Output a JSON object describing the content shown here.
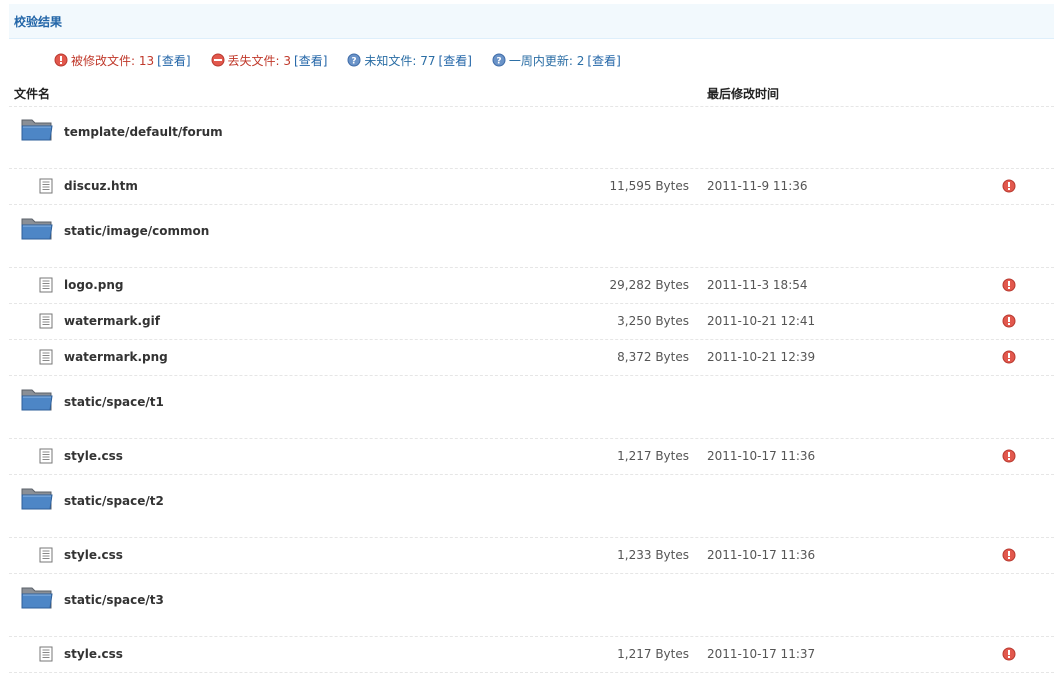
{
  "title": "校验结果",
  "summary": {
    "modified": {
      "label": "被修改文件: 13",
      "view": "[查看]"
    },
    "missing": {
      "label": "丢失文件: 3",
      "view": "[查看]"
    },
    "unknown": {
      "label": "未知文件: 77",
      "view": "[查看]"
    },
    "weekly": {
      "label": "一周内更新: 2",
      "view": "[查看]"
    }
  },
  "header": {
    "name": "文件名",
    "modified_time": "最后修改时间"
  },
  "rows": [
    {
      "type": "folder",
      "name": "template/default/forum"
    },
    {
      "type": "file",
      "name": "discuz.htm",
      "size": "11,595 Bytes",
      "time": "2011-11-9 11:36",
      "status": "modified"
    },
    {
      "type": "folder",
      "name": "static/image/common"
    },
    {
      "type": "file",
      "name": "logo.png",
      "size": "29,282 Bytes",
      "time": "2011-11-3 18:54",
      "status": "modified"
    },
    {
      "type": "file",
      "name": "watermark.gif",
      "size": "3,250 Bytes",
      "time": "2011-10-21 12:41",
      "status": "modified"
    },
    {
      "type": "file",
      "name": "watermark.png",
      "size": "8,372 Bytes",
      "time": "2011-10-21 12:39",
      "status": "modified"
    },
    {
      "type": "folder",
      "name": "static/space/t1"
    },
    {
      "type": "file",
      "name": "style.css",
      "size": "1,217 Bytes",
      "time": "2011-10-17 11:36",
      "status": "modified"
    },
    {
      "type": "folder",
      "name": "static/space/t2"
    },
    {
      "type": "file",
      "name": "style.css",
      "size": "1,233 Bytes",
      "time": "2011-10-17 11:36",
      "status": "modified"
    },
    {
      "type": "folder",
      "name": "static/space/t3"
    },
    {
      "type": "file",
      "name": "style.css",
      "size": "1,217 Bytes",
      "time": "2011-10-17 11:37",
      "status": "modified"
    }
  ],
  "icons": {
    "modified": "error-icon",
    "missing": "minus-icon",
    "unknown": "question-icon",
    "weekly": "question-icon",
    "folder": "folder-icon",
    "file": "file-icon"
  },
  "colors": {
    "title": "#2366a8",
    "modified": "#c0392b",
    "link": "#2366a8"
  }
}
